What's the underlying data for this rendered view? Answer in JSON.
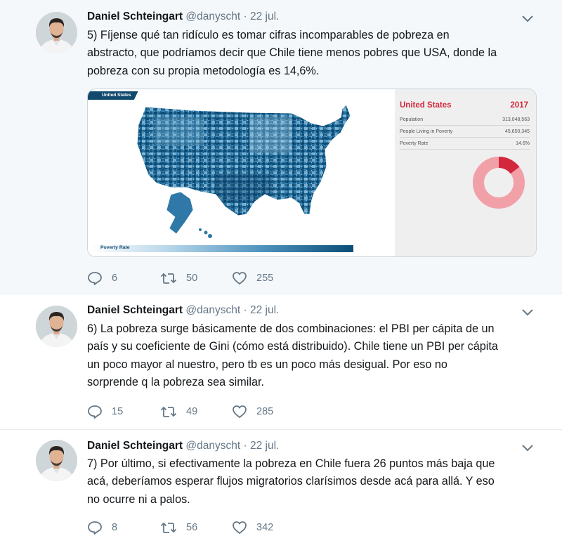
{
  "tweets": [
    {
      "name": "Daniel Schteingart",
      "handle": "@danyscht",
      "separator": "·",
      "date": "22 jul.",
      "text_lines": [
        "5) Fíjense qué tan ridículo es tomar cifras incomparables de pobreza en",
        "abstracto, que podríamos decir que Chile tiene menos pobres que USA, donde la",
        "pobreza con su propia metodología es 14,6%."
      ],
      "replies": "6",
      "retweets": "50",
      "likes": "255",
      "media": {
        "ribbon": "United States",
        "legend_label": "Poverty Rate",
        "region": "United States",
        "year": "2017",
        "stats": [
          {
            "label": "Population",
            "value": "313,048,563"
          },
          {
            "label": "People Living in Poverty",
            "value": "45,650,345"
          },
          {
            "label": "Poverty Rate",
            "value": "14.6%"
          }
        ],
        "poverty_rate_fraction": 0.146,
        "accent_color": "#d3273c",
        "map_color": "#1d6896"
      }
    },
    {
      "name": "Daniel Schteingart",
      "handle": "@danyscht",
      "separator": "·",
      "date": "22 jul.",
      "text_lines": [
        "6) La pobreza surge básicamente de dos combinaciones: el PBI per cápita de un",
        "país y su coeficiente de Gini (cómo está distribuido). Chile tiene un PBI per cápita",
        "un poco mayor al nuestro, pero tb es un poco más desigual. Por eso no",
        "sorprende q la pobreza sea similar."
      ],
      "replies": "15",
      "retweets": "49",
      "likes": "285"
    },
    {
      "name": "Daniel Schteingart",
      "handle": "@danyscht",
      "separator": "·",
      "date": "22 jul.",
      "text_lines": [
        "7) Por último, si efectivamente la pobreza en Chile fuera 26 puntos más baja que",
        "acá, deberíamos esperar flujos migratorios clarísimos desde acá para allá. Y eso",
        "no ocurre ni a palos."
      ],
      "replies": "8",
      "retweets": "56",
      "likes": "342"
    }
  ],
  "icons": {
    "reply": "reply-icon",
    "retweet": "retweet-icon",
    "like": "heart-icon",
    "caret": "chevron-down-icon"
  },
  "colors": {
    "thread_line": "#b9d6ea",
    "muted_text": "#657786",
    "highlight_bg": "#f5f8fa"
  }
}
